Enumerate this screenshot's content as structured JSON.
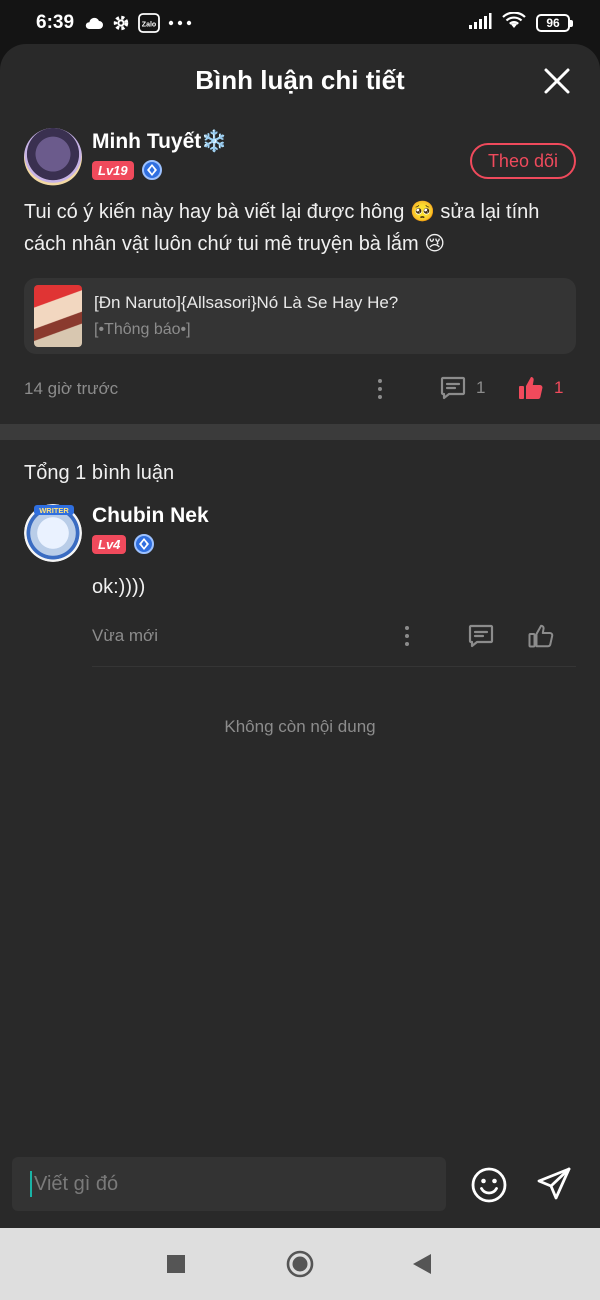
{
  "status_bar": {
    "time": "6:39",
    "battery": "96",
    "zalo_label": "Zalo"
  },
  "header": {
    "title": "Bình luận chi tiết"
  },
  "post": {
    "author_name": "Minh Tuyết❄️",
    "level": "Lv19",
    "follow_label": "Theo dõi",
    "text": "Tui có ý kiến này hay bà viết lại được hông 🥺 sửa lại tính cách nhân vật luôn chứ tui mê truyện bà lắm 😢",
    "story": {
      "title": "[Đn Naruto]{Allsasori}Nó Là Se Hay He?",
      "subtitle": "[•Thông báo•]"
    },
    "time": "14 giờ trước",
    "reply_count": "1",
    "like_count": "1"
  },
  "comments": {
    "total_label": "Tổng 1 bình luận",
    "items": [
      {
        "author_name": "Chubin Nek",
        "level": "Lv4",
        "avatar_label": "WRITER",
        "text": "ok:))))",
        "time": "Vừa mới"
      }
    ],
    "end_label": "Không còn nội dung"
  },
  "input": {
    "placeholder": "Viết gì đó"
  },
  "colors": {
    "accent": "#f04a5c",
    "sheet_bg": "#292929",
    "muted": "#8c8c8c"
  }
}
